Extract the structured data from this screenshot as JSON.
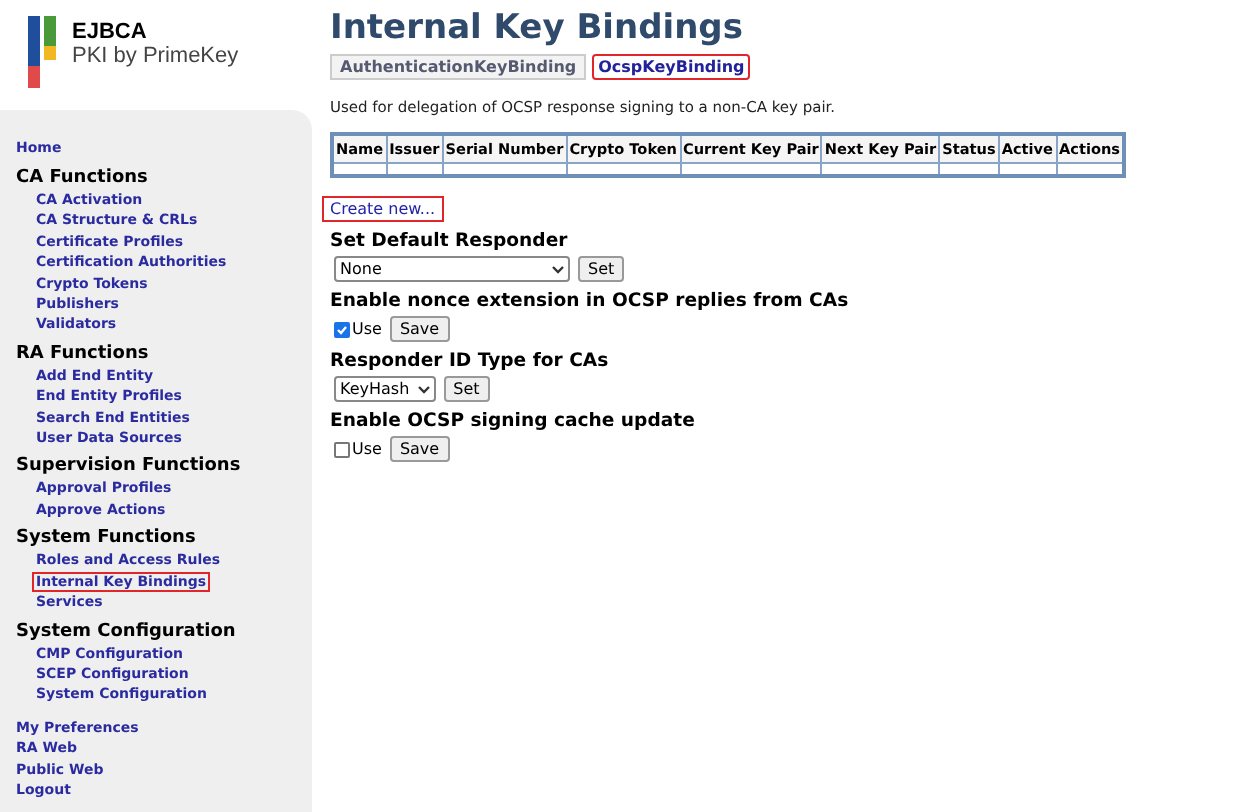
{
  "logo": {
    "name": "EJBCA",
    "tagline": "PKI by PrimeKey"
  },
  "sidebar": {
    "groups": [
      {
        "kind": "link",
        "label": "Home",
        "highlighted": false
      },
      {
        "kind": "section",
        "title": "CA Functions",
        "items": [
          {
            "label": "CA Activation",
            "highlighted": false
          },
          {
            "label": "CA Structure & CRLs",
            "highlighted": false
          },
          {
            "label": "Certificate Profiles",
            "highlighted": false
          },
          {
            "label": "Certification Authorities",
            "highlighted": false
          },
          {
            "label": "Crypto Tokens",
            "highlighted": false
          },
          {
            "label": "Publishers",
            "highlighted": false
          },
          {
            "label": "Validators",
            "highlighted": false
          }
        ]
      },
      {
        "kind": "section",
        "title": "RA Functions",
        "items": [
          {
            "label": "Add End Entity",
            "highlighted": false
          },
          {
            "label": "End Entity Profiles",
            "highlighted": false
          },
          {
            "label": "Search End Entities",
            "highlighted": false
          },
          {
            "label": "User Data Sources",
            "highlighted": false
          }
        ]
      },
      {
        "kind": "section",
        "title": "Supervision Functions",
        "items": [
          {
            "label": "Approval Profiles",
            "highlighted": false
          },
          {
            "label": "Approve Actions",
            "highlighted": false
          }
        ]
      },
      {
        "kind": "section",
        "title": "System Functions",
        "items": [
          {
            "label": "Roles and Access Rules",
            "highlighted": false
          },
          {
            "label": "Internal Key Bindings",
            "highlighted": true
          },
          {
            "label": "Services",
            "highlighted": false
          }
        ]
      },
      {
        "kind": "section",
        "title": "System Configuration",
        "items": [
          {
            "label": "CMP Configuration",
            "highlighted": false
          },
          {
            "label": "SCEP Configuration",
            "highlighted": false
          },
          {
            "label": "System Configuration",
            "highlighted": false
          }
        ]
      },
      {
        "kind": "links",
        "items": [
          {
            "label": "My Preferences",
            "highlighted": false
          },
          {
            "label": "RA Web",
            "highlighted": false
          },
          {
            "label": "Public Web",
            "highlighted": false
          },
          {
            "label": "Logout",
            "highlighted": false
          }
        ]
      }
    ]
  },
  "page_title": "Internal Key Bindings",
  "tabs": [
    {
      "label": "AuthenticationKeyBinding",
      "selected": false,
      "highlighted": false
    },
    {
      "label": "OcspKeyBinding",
      "selected": true,
      "highlighted": true
    }
  ],
  "description": "Used for delegation of OCSP response signing to a non-CA key pair.",
  "table": {
    "columns": [
      "Name",
      "Issuer",
      "Serial Number",
      "Crypto Token",
      "Current Key Pair",
      "Next Key Pair",
      "Status",
      "Active",
      "Actions"
    ]
  },
  "create_link": {
    "label": "Create new...",
    "highlighted": true
  },
  "sections": [
    {
      "kind": "select",
      "title": "Set Default Responder",
      "value": "None",
      "button": "Set",
      "wide": true
    },
    {
      "kind": "checkbox",
      "title": "Enable nonce extension in OCSP replies from CAs",
      "label": "Use",
      "checked": true,
      "button": "Save"
    },
    {
      "kind": "select",
      "title": "Responder ID Type for CAs",
      "value": "KeyHash",
      "button": "Set",
      "wide": false
    },
    {
      "kind": "checkbox",
      "title": "Enable OCSP signing cache update",
      "label": "Use",
      "checked": false,
      "button": "Save"
    }
  ]
}
